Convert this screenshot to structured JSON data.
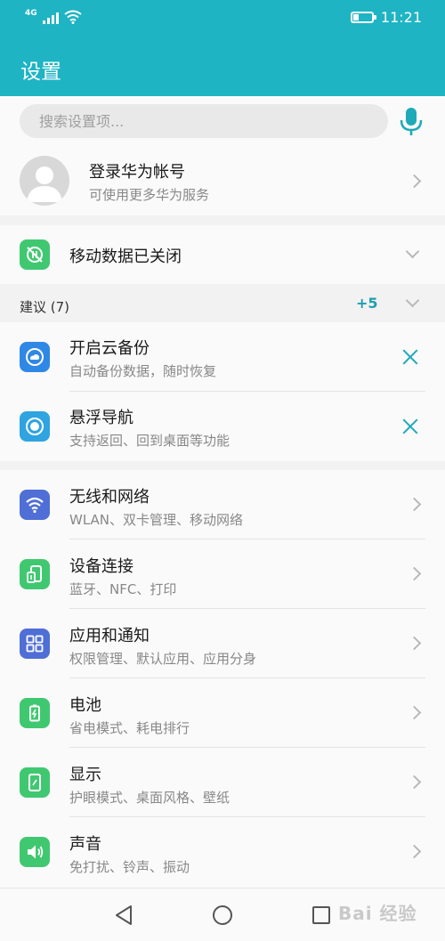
{
  "status_bar": {
    "network_type": "4G",
    "time": "11:21",
    "icons": [
      "signal-icon",
      "wifi-icon",
      "battery-icon"
    ]
  },
  "app_bar": {
    "title": "设置"
  },
  "search": {
    "placeholder": "搜索设置项...",
    "mic_icon": "microphone-icon"
  },
  "account": {
    "title": "登录华为帐号",
    "subtitle": "可使用更多华为服务"
  },
  "mobile_data": {
    "label": "移动数据已关闭",
    "icon": "mobile-data-off-icon"
  },
  "suggestions": {
    "header": "建议 (7)",
    "more": "+5",
    "items": [
      {
        "title": "开启云备份",
        "subtitle": "自动备份数据，随时恢复",
        "icon": "cloud-backup-icon"
      },
      {
        "title": "悬浮导航",
        "subtitle": "支持返回、回到桌面等功能",
        "icon": "floating-nav-icon"
      }
    ]
  },
  "settings": [
    {
      "title": "无线和网络",
      "subtitle": "WLAN、双卡管理、移动网络",
      "icon": "wifi-icon"
    },
    {
      "title": "设备连接",
      "subtitle": "蓝牙、NFC、打印",
      "icon": "device-connect-icon"
    },
    {
      "title": "应用和通知",
      "subtitle": "权限管理、默认应用、应用分身",
      "icon": "apps-icon"
    },
    {
      "title": "电池",
      "subtitle": "省电模式、耗电排行",
      "icon": "battery-icon"
    },
    {
      "title": "显示",
      "subtitle": "护眼模式、桌面风格、壁纸",
      "icon": "display-icon"
    },
    {
      "title": "声音",
      "subtitle": "免打扰、铃声、振动",
      "icon": "sound-icon"
    }
  ],
  "watermark": "Bai 经验",
  "colors": {
    "accent": "#1eb4c4",
    "green": "#40c870",
    "blue": "#2f88e6",
    "indigo": "#4f6fd6"
  }
}
